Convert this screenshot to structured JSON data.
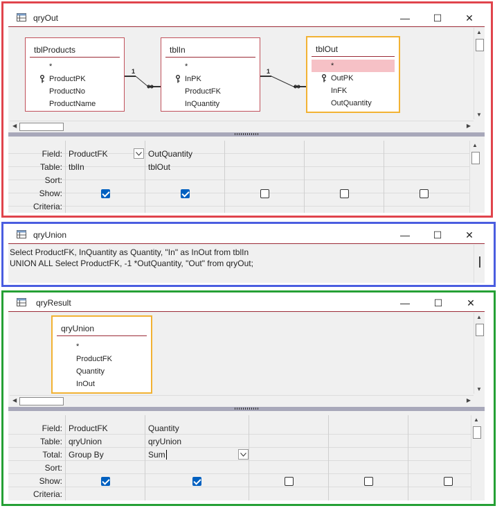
{
  "colors": {
    "red_outline": "#e0444c",
    "blue_outline": "#4a5de0",
    "green_outline": "#25a035",
    "table_selected": "#f2b233",
    "title_underline": "#9b2a36",
    "check_blue": "#0060c0"
  },
  "qryOut": {
    "title": "qryOut",
    "tables": [
      {
        "name": "tblProducts",
        "fields": [
          "*",
          "ProductPK",
          "ProductNo",
          "ProductName"
        ],
        "key_field": "ProductPK"
      },
      {
        "name": "tblIn",
        "fields": [
          "*",
          "InPK",
          "ProductFK",
          "InQuantity"
        ],
        "key_field": "InPK"
      },
      {
        "name": "tblOut",
        "fields": [
          "*",
          "OutPK",
          "InFK",
          "OutQuantity"
        ],
        "key_field": "OutPK",
        "selected": true
      }
    ],
    "join_labels": {
      "one": "1",
      "many": "∞"
    },
    "grid": {
      "row_labels": [
        "Field:",
        "Table:",
        "Sort:",
        "Show:",
        "Criteria:"
      ],
      "columns": [
        {
          "field": "ProductFK",
          "table": "tblIn",
          "show": true
        },
        {
          "field": "OutQuantity",
          "table": "tblOut",
          "show": true
        },
        {
          "field": "",
          "table": "",
          "show": false
        },
        {
          "field": "",
          "table": "",
          "show": false
        },
        {
          "field": "",
          "table": "",
          "show": false
        }
      ]
    }
  },
  "qryUnion": {
    "title": "qryUnion",
    "sql_line1": "Select ProductFK, InQuantity as Quantity, \"In\" as InOut from tblIn",
    "sql_line2": "UNION ALL Select ProductFK, -1 *OutQuantity, \"Out\" from qryOut;"
  },
  "qryResult": {
    "title": "qryResult",
    "table": {
      "name": "qryUnion",
      "fields": [
        "*",
        "ProductFK",
        "Quantity",
        "InOut"
      ]
    },
    "grid": {
      "row_labels": [
        "Field:",
        "Table:",
        "Total:",
        "Sort:",
        "Show:",
        "Criteria:"
      ],
      "columns": [
        {
          "field": "ProductFK",
          "table": "qryUnion",
          "total": "Group By",
          "show": true
        },
        {
          "field": "Quantity",
          "table": "qryUnion",
          "total": "Sum",
          "show": true
        },
        {
          "field": "",
          "table": "",
          "total": "",
          "show": false
        },
        {
          "field": "",
          "table": "",
          "total": "",
          "show": false
        },
        {
          "field": "",
          "table": "",
          "total": "",
          "show": false
        }
      ]
    }
  },
  "window_buttons": {
    "minimize": "—",
    "maximize": "☐",
    "close": "✕"
  }
}
